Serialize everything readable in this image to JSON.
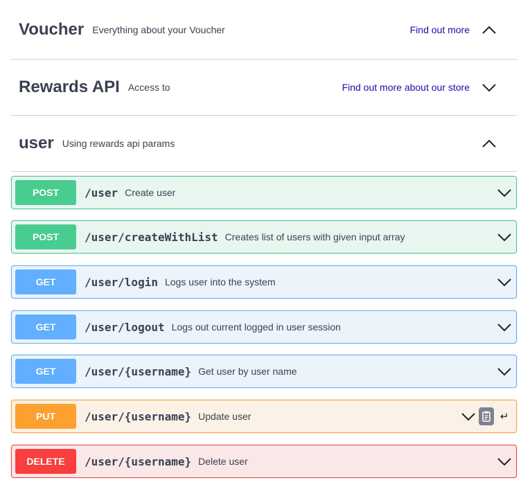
{
  "tags": [
    {
      "name": "Voucher",
      "description": "Everything about your Voucher",
      "link": "Find out more",
      "chevron": "chevron-up-icon"
    },
    {
      "name": "Rewards API",
      "description": "Access to",
      "link": "Find out more about our store",
      "chevron": "chevron-down-icon"
    },
    {
      "name": "user",
      "description": "Using rewards api params",
      "link": "",
      "chevron": "chevron-up-icon"
    }
  ],
  "operations": [
    {
      "method": "POST",
      "path": "/user",
      "summary": "Create user"
    },
    {
      "method": "POST",
      "path": "/user/createWithList",
      "summary": "Creates list of users with given input array"
    },
    {
      "method": "GET",
      "path": "/user/login",
      "summary": "Logs user into the system"
    },
    {
      "method": "GET",
      "path": "/user/logout",
      "summary": "Logs out current logged in user session"
    },
    {
      "method": "GET",
      "path": "/user/{username}",
      "summary": "Get user by user name"
    },
    {
      "method": "PUT",
      "path": "/user/{username}",
      "summary": "Update user",
      "extra_icons": [
        "copy-to-clipboard-icon",
        "enter-return-icon"
      ]
    },
    {
      "method": "DELETE",
      "path": "/user/{username}",
      "summary": "Delete user"
    }
  ],
  "colors": {
    "post": "#49cc90",
    "get": "#61affe",
    "put": "#fca130",
    "delete": "#f93e3e",
    "link": "#1a0dab",
    "text": "#3b4151"
  },
  "glyphs": {
    "enter": "↵"
  }
}
